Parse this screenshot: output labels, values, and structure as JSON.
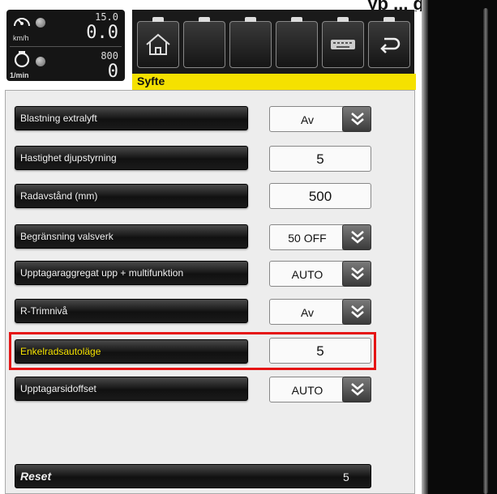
{
  "header": {
    "title_fragment": "yp ... g"
  },
  "gauges": {
    "speed": {
      "icon": "speedometer-icon",
      "set_value": "15.0",
      "value": "0.0",
      "unit": "km/h"
    },
    "rpm": {
      "icon": "engine-icon",
      "set_value": "800",
      "value": "0",
      "unit": "1/min"
    }
  },
  "toolbar": {
    "buttons": [
      {
        "name": "home",
        "icon": "home-icon"
      },
      {
        "name": "blank-1",
        "icon": ""
      },
      {
        "name": "blank-2",
        "icon": ""
      },
      {
        "name": "blank-3",
        "icon": ""
      },
      {
        "name": "keyboard",
        "icon": "keyboard-icon"
      },
      {
        "name": "back",
        "icon": "back-arrow-icon"
      }
    ]
  },
  "title_bar": {
    "label": "Syfte"
  },
  "params": [
    {
      "label": "Blastning extralyft",
      "value": "Av",
      "type": "dropdown"
    },
    {
      "label": "Hastighet djupstyrning",
      "value": "5",
      "type": "number"
    },
    {
      "label": "Radavstånd (mm)",
      "value": "500",
      "type": "number"
    },
    {
      "label": "Begränsning valsverk",
      "value": "50 OFF",
      "type": "dropdown"
    },
    {
      "label": "Upptagaraggregat upp + multifunktion",
      "value": "AUTO",
      "type": "dropdown"
    },
    {
      "label": "R-Trimnivå",
      "value": "Av",
      "type": "dropdown"
    },
    {
      "label": "Enkelradsautoläge",
      "value": "5",
      "type": "number",
      "active": true
    },
    {
      "label": "Upptagarsidoffset",
      "value": "AUTO",
      "type": "dropdown"
    }
  ],
  "reset": {
    "label": "Reset",
    "value": "5"
  },
  "colors": {
    "accent_yellow": "#f5e100",
    "highlight_red": "#e51414",
    "panel_dark": "#151515"
  }
}
